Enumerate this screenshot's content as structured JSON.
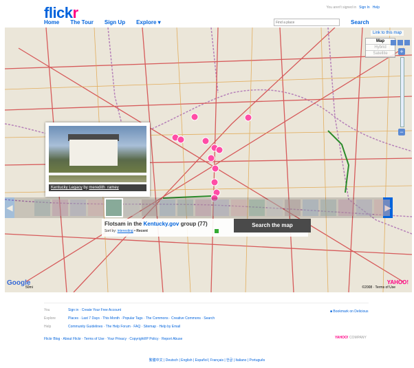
{
  "header": {
    "logo_main": "flick",
    "logo_r": "r",
    "nav": [
      "Home",
      "The Tour",
      "Sign Up",
      "Explore"
    ],
    "explore_caret": "▾",
    "signin_note": "You aren't signed in",
    "signin": "Sign In",
    "help": "Help",
    "place_placeholder": "Find a place",
    "search": "Search"
  },
  "map": {
    "link_to_map": "Link to this map",
    "types": [
      "Map",
      "Hybrid",
      "Satellite"
    ],
    "zoom_in": "+",
    "zoom_out": "−",
    "photo_caption_title": "Kentucky Legacy",
    "photo_caption_by": "by",
    "photo_caption_author": "meredith_ramey",
    "group_prefix": "Flotsam in the",
    "group_name": "Kentucky.gov",
    "group_suffix": "group (77)",
    "sort_by": "Sort by:",
    "sort_interesting": "interesting",
    "sort_recent": "• Recent",
    "search_map_button": "Search the map",
    "google": "Google",
    "scale": "50mi",
    "copyright": "©2008 · Terms of Use",
    "yahoo": "YAHOO!",
    "colors": {
      "road_major": "#d65a5a",
      "road_minor": "#e0a040",
      "state_border": "#b57fb8",
      "marker": "#ff4da6"
    },
    "thumb_count": 20,
    "active_thumb": 4
  },
  "footer": {
    "rows": [
      {
        "k": "You",
        "v": "Sign in · Create Your Free Account"
      },
      {
        "k": "Explore",
        "v": "Places · Last 7 Days · This Month · Popular Tags · The Commons · Creative Commons · Search"
      },
      {
        "k": "Help",
        "v": "Community Guidelines · The Help Forum · FAQ · Sitemap · Help by Email"
      }
    ],
    "links_line": "Flickr Blog · About Flickr · Terms of Use · Your Privacy · Copyright/IP Policy · Report Abuse",
    "bookmark": "Bookmark on Delicious",
    "yahoo_brand": "YAHOO!",
    "yahoo_company": "COMPANY",
    "languages": "繁體中文 | Deutsch | English | Español | Français | 한글 | Italiano | Português"
  }
}
